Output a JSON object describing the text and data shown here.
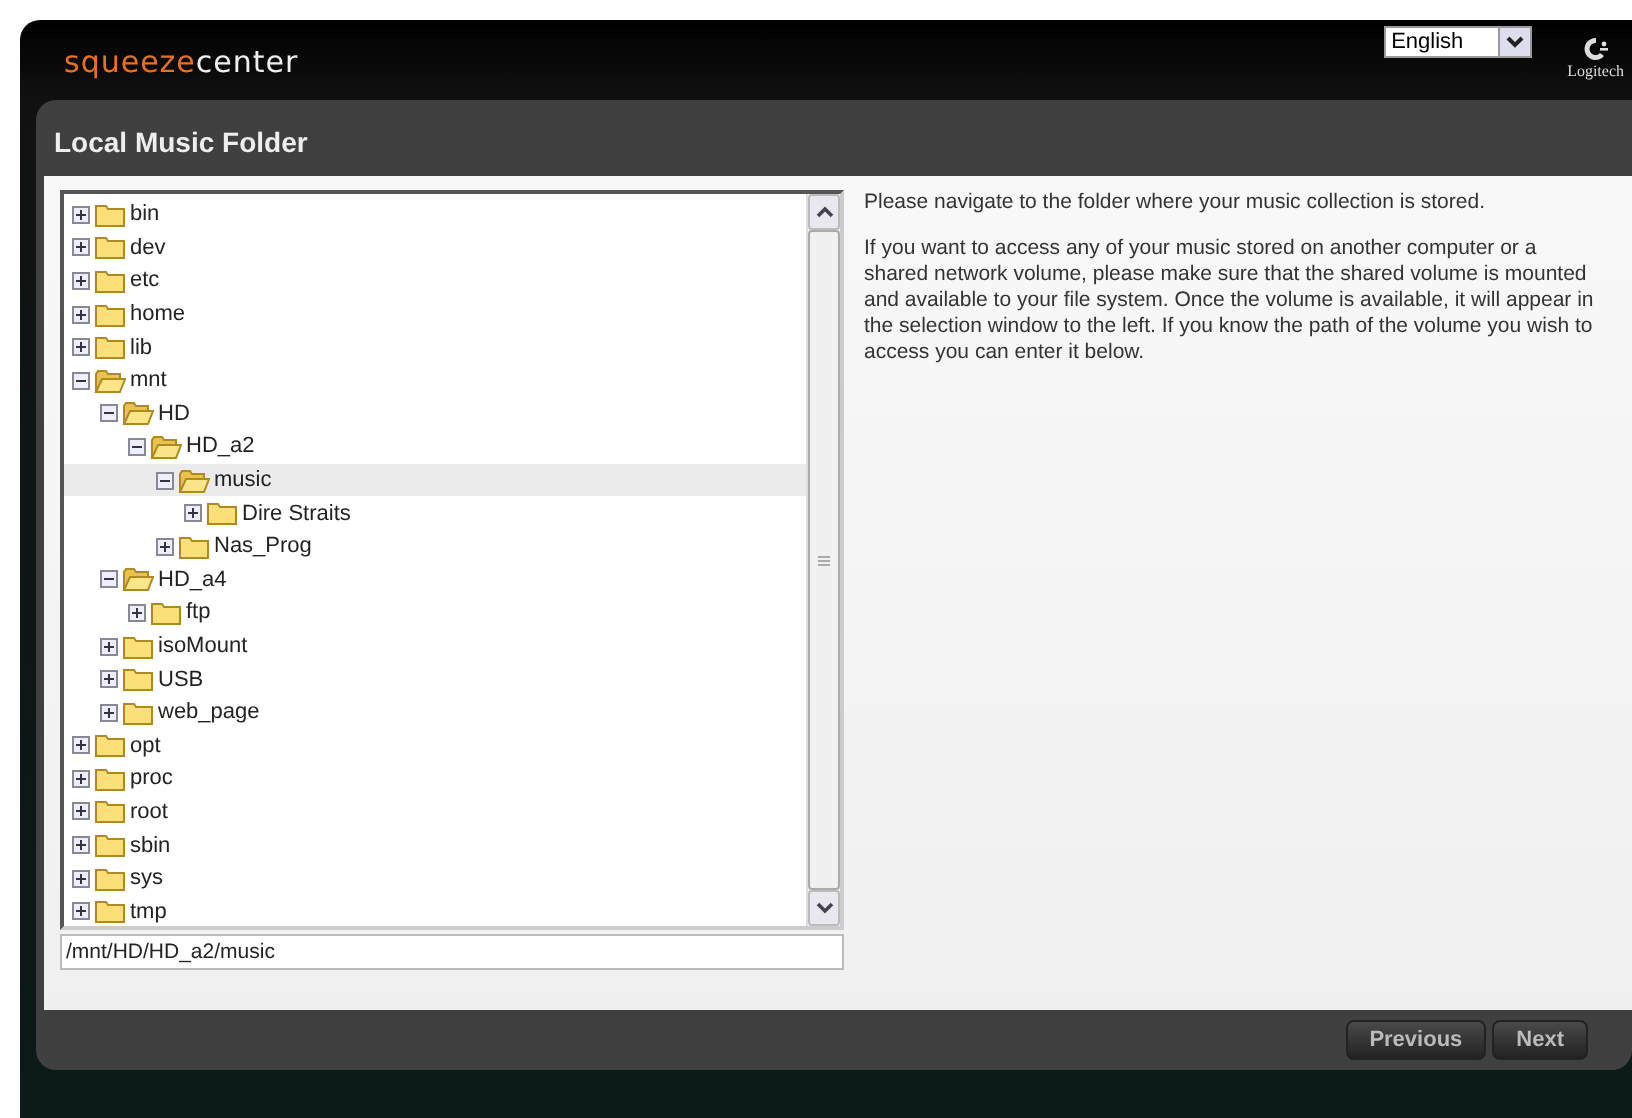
{
  "header": {
    "logo": [
      "squeeze",
      "center"
    ],
    "language": "English",
    "brand": "Logitech"
  },
  "panel": {
    "title": "Local Music Folder"
  },
  "tree": [
    {
      "label": "bin",
      "expanded": false,
      "selected": false
    },
    {
      "label": "dev",
      "expanded": false,
      "selected": false
    },
    {
      "label": "etc",
      "expanded": false,
      "selected": false
    },
    {
      "label": "home",
      "expanded": false,
      "selected": false
    },
    {
      "label": "lib",
      "expanded": false,
      "selected": false
    },
    {
      "label": "mnt",
      "expanded": true,
      "selected": false,
      "children": [
        {
          "label": "HD",
          "expanded": true,
          "selected": false,
          "children": [
            {
              "label": "HD_a2",
              "expanded": true,
              "selected": false,
              "children": [
                {
                  "label": "music",
                  "expanded": true,
                  "selected": true,
                  "children": [
                    {
                      "label": "Dire Straits",
                      "expanded": false,
                      "selected": false
                    }
                  ]
                },
                {
                  "label": "Nas_Prog",
                  "expanded": false,
                  "selected": false
                }
              ]
            }
          ]
        },
        {
          "label": "HD_a4",
          "expanded": true,
          "selected": false,
          "children": [
            {
              "label": "ftp",
              "expanded": false,
              "selected": false
            }
          ]
        },
        {
          "label": "isoMount",
          "expanded": false,
          "selected": false
        },
        {
          "label": "USB",
          "expanded": false,
          "selected": false
        },
        {
          "label": "web_page",
          "expanded": false,
          "selected": false
        }
      ]
    },
    {
      "label": "opt",
      "expanded": false,
      "selected": false
    },
    {
      "label": "proc",
      "expanded": false,
      "selected": false
    },
    {
      "label": "root",
      "expanded": false,
      "selected": false
    },
    {
      "label": "sbin",
      "expanded": false,
      "selected": false
    },
    {
      "label": "sys",
      "expanded": false,
      "selected": false
    },
    {
      "label": "tmp",
      "expanded": false,
      "selected": false
    }
  ],
  "path_field": {
    "value": "/mnt/HD/HD_a2/music"
  },
  "help": [
    "Please navigate to the folder where your music collection is stored.",
    "If you want to access any of your music stored on another computer or a shared network volume, please make sure that the shared volume is mounted and available to your file system. Once the volume is available, it will appear in the selection window to the left. If you know the path of the volume you wish to access you can enter it below."
  ],
  "buttons": [
    "Previous",
    "Next"
  ]
}
